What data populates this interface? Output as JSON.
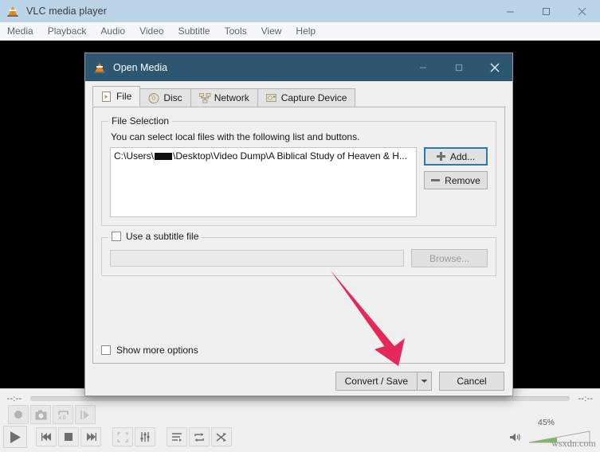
{
  "window": {
    "title": "VLC media player",
    "logo_icon": "vlc-cone-icon",
    "controls": {
      "minimize": "minimize-icon",
      "maximize": "maximize-icon",
      "close": "close-icon"
    }
  },
  "menubar": {
    "items": [
      {
        "label": "Media"
      },
      {
        "label": "Playback"
      },
      {
        "label": "Audio"
      },
      {
        "label": "Video"
      },
      {
        "label": "Subtitle"
      },
      {
        "label": "Tools"
      },
      {
        "label": "View"
      },
      {
        "label": "Help"
      }
    ]
  },
  "playback_bar": {
    "elapsed": "--:--",
    "remaining": "--:--",
    "seek_value": 0,
    "record_row": [
      {
        "name": "record-button",
        "icon": "record-icon"
      },
      {
        "name": "snapshot-button",
        "icon": "camera-icon"
      },
      {
        "name": "ab-loop-button",
        "icon": "ab-loop-icon"
      },
      {
        "name": "frame-by-frame-button",
        "icon": "frame-step-icon"
      }
    ],
    "transport": [
      {
        "name": "play-button",
        "icon": "play-icon"
      },
      {
        "name": "previous-button",
        "icon": "skip-backward-icon"
      },
      {
        "name": "stop-button",
        "icon": "stop-icon"
      },
      {
        "name": "next-button",
        "icon": "skip-forward-icon"
      },
      {
        "name": "fullscreen-button",
        "icon": "fullscreen-icon"
      },
      {
        "name": "extended-settings-button",
        "icon": "equalizer-icon"
      },
      {
        "name": "playlist-button",
        "icon": "playlist-icon"
      },
      {
        "name": "loop-button",
        "icon": "loop-icon"
      },
      {
        "name": "shuffle-button",
        "icon": "shuffle-icon"
      }
    ],
    "volume": {
      "percent_label": "45%",
      "value": 45,
      "icon": "speaker-icon"
    },
    "watermark": "wsxdn.com"
  },
  "dialog": {
    "title": "Open Media",
    "logo_icon": "vlc-cone-icon",
    "titlebar_color": "#2d5670",
    "controls": {
      "minimize": "minimize-icon",
      "maximize": "maximize-icon",
      "close": "close-icon"
    },
    "tabs": [
      {
        "label": "File",
        "icon": "file-icon",
        "active": true
      },
      {
        "label": "Disc",
        "icon": "disc-icon",
        "active": false
      },
      {
        "label": "Network",
        "icon": "network-icon",
        "active": false
      },
      {
        "label": "Capture Device",
        "icon": "capture-device-icon",
        "active": false
      }
    ],
    "file_selection": {
      "group_title": "File Selection",
      "hint": "You can select local files with the following list and buttons.",
      "file_path_prefix": "C:\\Users\\",
      "file_path_suffix": "\\Desktop\\Video Dump\\A Biblical Study of Heaven & H...",
      "add_button": {
        "label": "Add...",
        "icon": "plus-icon",
        "focused": true
      },
      "remove_button": {
        "label": "Remove",
        "icon": "minus-icon",
        "focused": false
      }
    },
    "subtitle_section": {
      "checkbox_label": "Use a subtitle file",
      "checked": false,
      "input_value": "",
      "browse_button": "Browse...",
      "disabled": true
    },
    "show_more_options": {
      "label": "Show more options",
      "checked": false
    },
    "footer": {
      "convert_save": "Convert / Save",
      "dropdown_icon": "chevron-down-icon",
      "cancel": "Cancel"
    }
  },
  "annotation": {
    "arrow_color": "#e5285a",
    "name": "red-pointer-arrow"
  }
}
